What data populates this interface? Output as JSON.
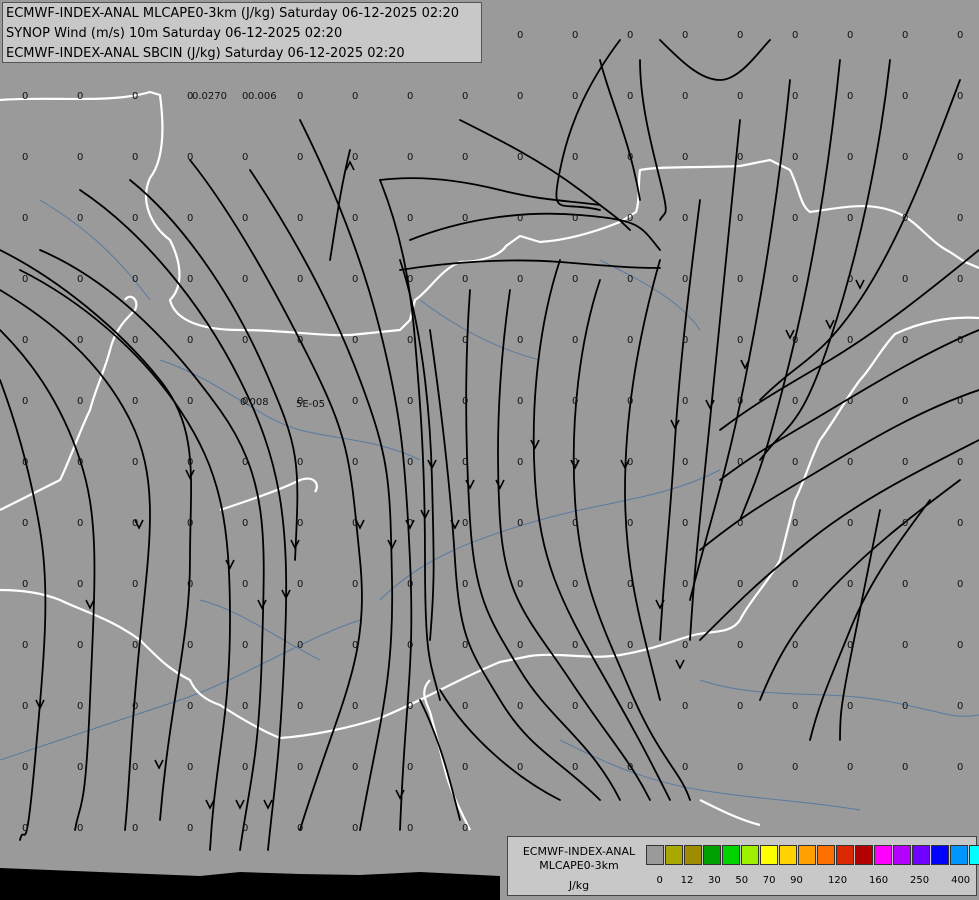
{
  "header": {
    "lines": [
      "ECMWF-INDEX-ANAL MLCAPE0-3km (J/kg) Saturday 06-12-2025 02:20",
      "SYNOP Wind (m/s) 10m Saturday 06-12-2025 02:20",
      "ECMWF-INDEX-ANAL SBCIN (J/kg) Saturday 06-12-2025 02:20"
    ]
  },
  "legend": {
    "name_line1": "ECMWF-INDEX-ANAL",
    "name_line2": "MLCAPE0-3km",
    "unit": "J/kg",
    "colors": [
      "#9a9a9a",
      "#a8a800",
      "#a08c00",
      "#00a000",
      "#00d400",
      "#9cf000",
      "#ffff00",
      "#ffd200",
      "#ffa000",
      "#ff7000",
      "#dc2800",
      "#b40000",
      "#ff00ff",
      "#b400ff",
      "#7000ff",
      "#0000ff",
      "#0096ff",
      "#00ffff",
      "#96ffff",
      "#ffffff"
    ],
    "ticks": [
      "0",
      "12",
      "30",
      "50",
      "70",
      "90",
      "120",
      "160",
      "250",
      "400"
    ]
  },
  "map": {
    "ocean_color": "#000000",
    "land_color": "#9a9a9a",
    "border_color": "#ffffff",
    "river_color": "#5a7aa0",
    "streamline_color": "#000000",
    "cin_labels": [
      "0.0270",
      "0.006",
      "0.008",
      "5E-05"
    ],
    "grid_value": "0"
  }
}
